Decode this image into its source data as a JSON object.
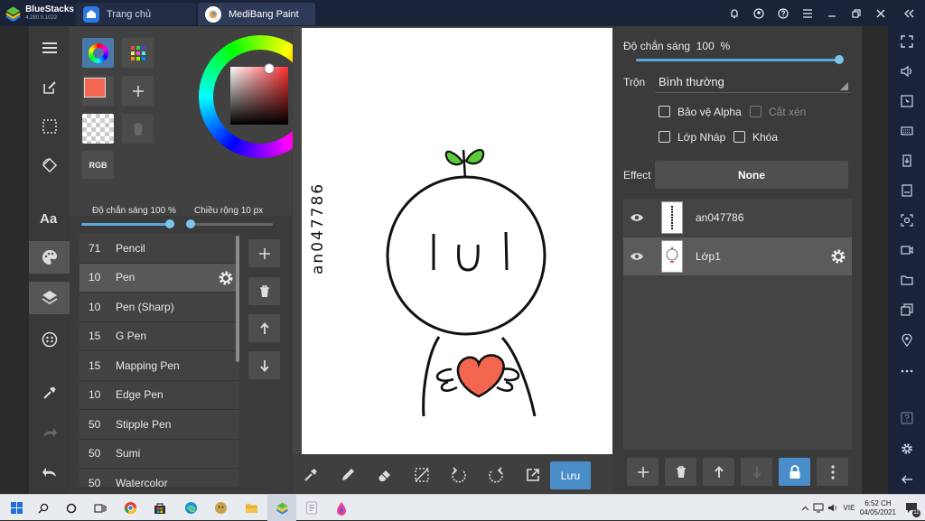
{
  "bluestacks": {
    "name": "BlueStacks",
    "version": "4.280.0.1022",
    "tabs": [
      {
        "label": "Trang chủ"
      },
      {
        "label": "MediBang Paint"
      }
    ]
  },
  "color_panel": {
    "rgb_label": "RGB",
    "foreground_color": "#f26650",
    "opacity_label": "Độ chắn sáng",
    "opacity_value": "100",
    "opacity_unit": "%",
    "opacity_fraction": 1.0,
    "width_label": "Chiều rộng",
    "width_value": "10",
    "width_unit": "px",
    "width_fraction": 0.05
  },
  "brushes": [
    {
      "size": "71",
      "name": "Pencil"
    },
    {
      "size": "10",
      "name": "Pen"
    },
    {
      "size": "10",
      "name": "Pen (Sharp)"
    },
    {
      "size": "15",
      "name": "G Pen"
    },
    {
      "size": "15",
      "name": "Mapping Pen"
    },
    {
      "size": "10",
      "name": "Edge Pen"
    },
    {
      "size": "50",
      "name": "Stipple Pen"
    },
    {
      "size": "50",
      "name": "Sumi"
    },
    {
      "size": "50",
      "name": "Watercolor"
    }
  ],
  "canvas": {
    "signature": "an047786"
  },
  "bottom_toolbar": {
    "save_label": "Lưu"
  },
  "layer_panel": {
    "opacity_label": "Độ chắn sáng",
    "opacity_value": "100",
    "opacity_unit": "%",
    "opacity_fraction": 1.0,
    "blend_label": "Trộn",
    "blend_value": "Bình thường",
    "protect_alpha_label": "Bảo vệ Alpha",
    "clipping_label": "Cắt xén",
    "draft_layer_label": "Lớp Nháp",
    "lock_label": "Khóa",
    "effect_label": "Effect",
    "effect_value": "None",
    "layers": [
      {
        "name": "an047786"
      },
      {
        "name": "Lớp1"
      }
    ]
  },
  "taskbar": {
    "time": "6:52 CH",
    "date": "04/05/2021",
    "language": "VIE",
    "notification_count": "11"
  }
}
